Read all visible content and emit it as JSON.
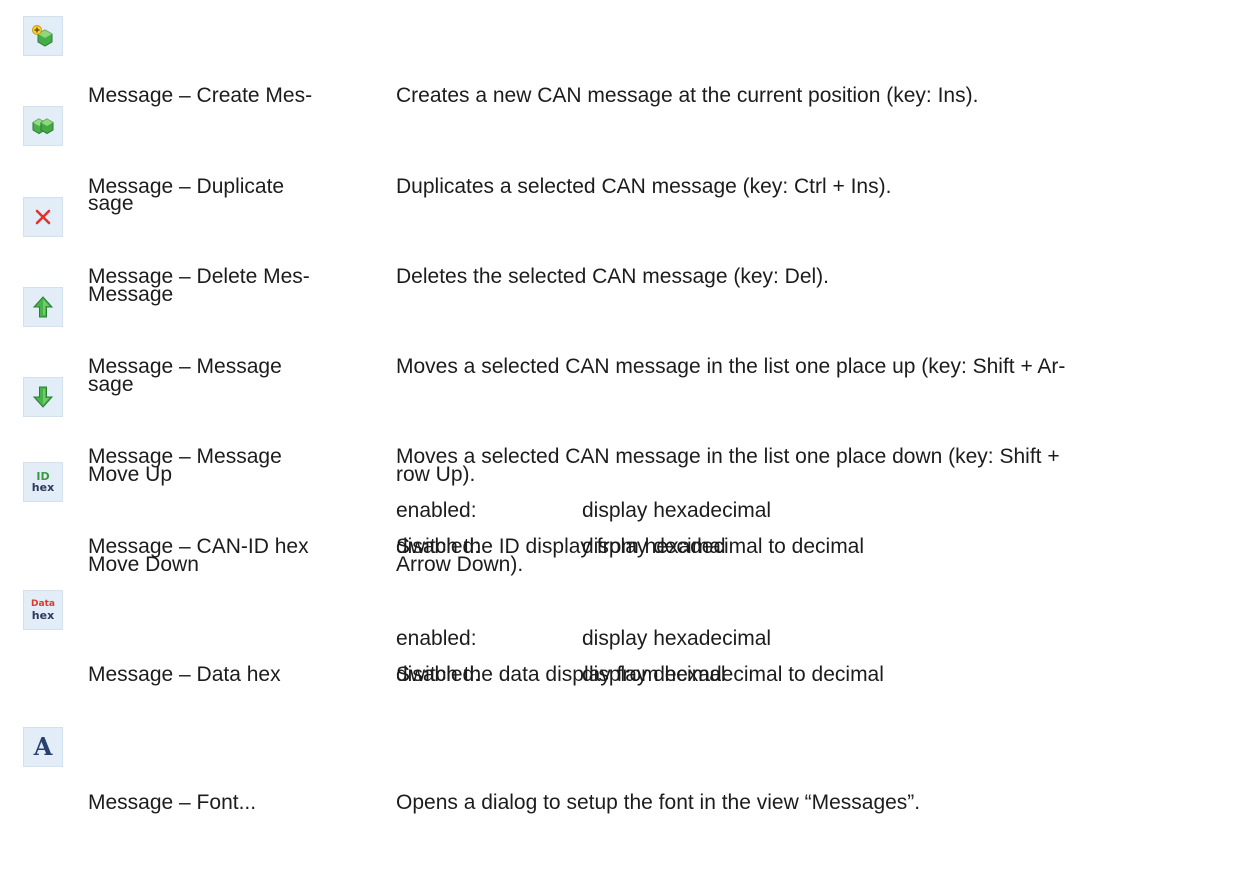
{
  "rows": [
    {
      "icon": "create-message-icon",
      "name_lines": [
        "Message – Create Mes-",
        "sage"
      ],
      "desc_lines": [
        "Creates a new CAN message at the current position (key: Ins)."
      ]
    },
    {
      "icon": "duplicate-message-icon",
      "name_lines": [
        "Message – Duplicate",
        "Message"
      ],
      "desc_lines": [
        "Duplicates a selected CAN message (key: Ctrl + Ins)."
      ]
    },
    {
      "icon": "delete-message-icon",
      "name_lines": [
        "Message – Delete Mes-",
        "sage"
      ],
      "desc_lines": [
        "Deletes the selected CAN message (key: Del)."
      ]
    },
    {
      "icon": "arrow-up-icon",
      "name_lines": [
        "Message – Message",
        "Move Up"
      ],
      "desc_lines": [
        "Moves a selected CAN message in the list one place up (key: Shift + Ar-",
        "row Up)."
      ]
    },
    {
      "icon": "arrow-down-icon",
      "name_lines": [
        "Message – Message",
        "Move Down"
      ],
      "desc_lines": [
        "Moves a selected CAN message in the list one place down (key: Shift +",
        "Arrow Down)."
      ]
    },
    {
      "icon": "id-hex-icon",
      "icon_text": [
        "ID",
        "hex"
      ],
      "name_lines": [
        "Message – CAN-ID hex"
      ],
      "desc_lines": [
        "Switch the ID display from hexadecimal to decimal"
      ],
      "options": [
        {
          "key": "enabled:",
          "value": "display hexadecimal"
        },
        {
          "key": "disabled:",
          "value": "display decimal"
        }
      ]
    },
    {
      "icon": "data-hex-icon",
      "icon_text": [
        "Data",
        "hex"
      ],
      "name_lines": [
        "Message – Data hex"
      ],
      "desc_lines": [
        "Switch the data display from hexadecimal to decimal"
      ],
      "options": [
        {
          "key": "enabled:",
          "value": "display hexadecimal"
        },
        {
          "key": "disabled:",
          "value": "display decimal"
        }
      ]
    },
    {
      "icon": "font-icon",
      "icon_text": [
        "A"
      ],
      "name_lines": [
        "Message – Font..."
      ],
      "desc_lines": [
        "Opens a dialog to setup the font in the view “Messages”."
      ]
    }
  ],
  "colors": {
    "icon_bg": "#e3edf8",
    "green": "#3aa73a",
    "red": "#e0332c",
    "text": "#1c1c1c"
  }
}
